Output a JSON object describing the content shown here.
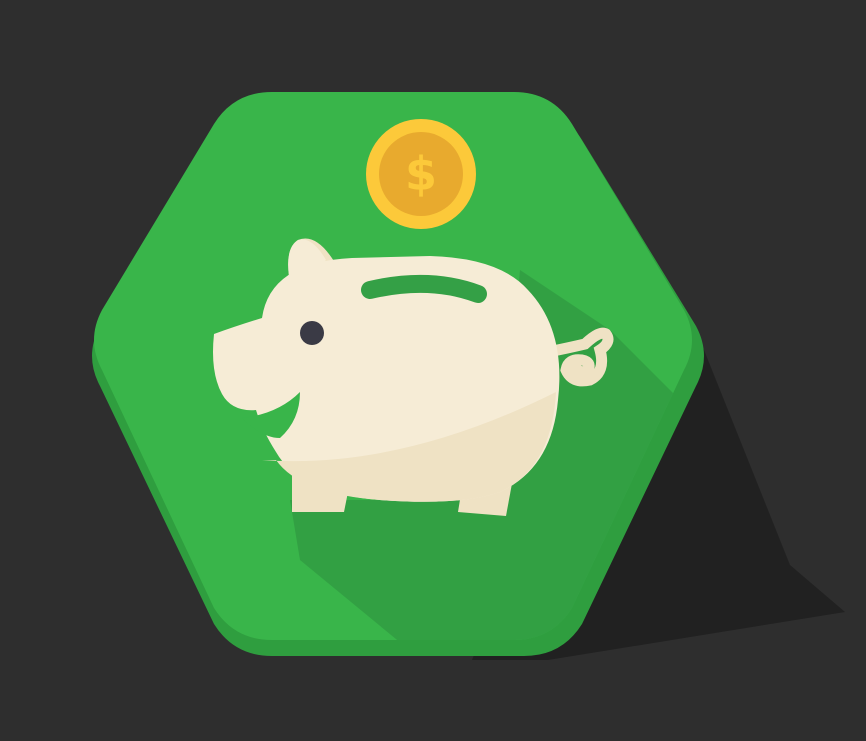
{
  "icon": {
    "name": "piggy-bank",
    "coin_symbol": "$"
  },
  "colors": {
    "background": "#2e2e2e",
    "long_shadow": "#212121",
    "hexagon_face": "#39b54a",
    "hexagon_edge": "#2f9e3f",
    "inner_shadow": "#32a043",
    "pig_body": "#f6ecd6",
    "pig_shade": "#efe2c4",
    "pig_slot": "#34a046",
    "pig_eye": "#3a3a45",
    "coin_outer": "#fcc93a",
    "coin_inner": "#e8aa2e",
    "coin_symbol": "#fcc93a"
  }
}
